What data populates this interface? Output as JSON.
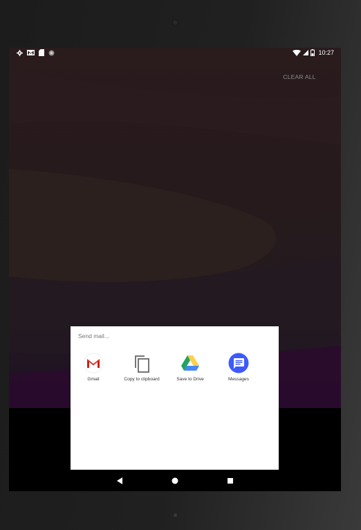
{
  "status_bar": {
    "left_icons": [
      "settings-icon",
      "gmail-notification-icon",
      "sd-card-icon",
      "circle-icon"
    ],
    "right_icons": [
      "wifi-icon",
      "cellular-signal-icon",
      "battery-icon"
    ],
    "time": "10:27"
  },
  "recents": {
    "clear_all_label": "CLEAR ALL"
  },
  "share_sheet": {
    "title": "Send mail...",
    "targets": [
      {
        "label": "Gmail",
        "icon": "gmail-icon"
      },
      {
        "label": "Copy to clipboard",
        "icon": "copy-icon"
      },
      {
        "label": "Save to Drive",
        "icon": "google-drive-icon"
      },
      {
        "label": "Messages",
        "icon": "messages-icon"
      }
    ]
  },
  "nav_bar": {
    "buttons": [
      "back-icon",
      "home-icon",
      "recents-icon"
    ]
  },
  "colors": {
    "sheet_background": "#ffffff",
    "screen_background": "#000000",
    "gmail_red": "#d93025",
    "drive_green": "#1fa463",
    "drive_yellow": "#ffd04b",
    "drive_blue": "#4688f4",
    "messages_blue": "#3d5afe"
  }
}
